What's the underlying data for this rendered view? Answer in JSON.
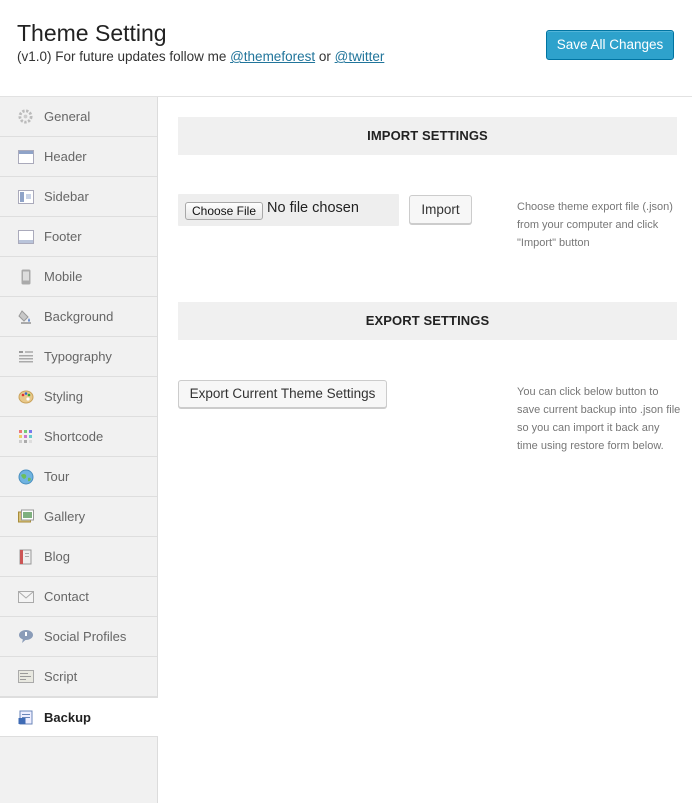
{
  "header": {
    "title": "Theme Setting",
    "subtitle_prefix": "(v1.0) For future updates follow me ",
    "link1": "@themeforest",
    "subtitle_mid": " or ",
    "link2": "@twitter",
    "save_label": "Save All Changes"
  },
  "sidebar": {
    "items": [
      {
        "label": "General",
        "icon": "gear-icon"
      },
      {
        "label": "Header",
        "icon": "header-layout-icon"
      },
      {
        "label": "Sidebar",
        "icon": "sidebar-layout-icon"
      },
      {
        "label": "Footer",
        "icon": "footer-layout-icon"
      },
      {
        "label": "Mobile",
        "icon": "mobile-icon"
      },
      {
        "label": "Background",
        "icon": "paint-bucket-icon"
      },
      {
        "label": "Typography",
        "icon": "typography-icon"
      },
      {
        "label": "Styling",
        "icon": "palette-icon"
      },
      {
        "label": "Shortcode",
        "icon": "shortcode-grid-icon"
      },
      {
        "label": "Tour",
        "icon": "globe-icon"
      },
      {
        "label": "Gallery",
        "icon": "gallery-icon"
      },
      {
        "label": "Blog",
        "icon": "book-icon"
      },
      {
        "label": "Contact",
        "icon": "envelope-icon"
      },
      {
        "label": "Social Profiles",
        "icon": "speech-bubble-icon"
      },
      {
        "label": "Script",
        "icon": "script-icon"
      },
      {
        "label": "Backup",
        "icon": "backup-icon"
      }
    ],
    "active": "Backup"
  },
  "import": {
    "heading": "IMPORT SETTINGS",
    "choose_file_label": "Choose File",
    "no_file_text": "No file chosen",
    "import_label": "Import",
    "help": "Choose theme export file (.json) from your computer and click \"Import\" button"
  },
  "export": {
    "heading": "EXPORT SETTINGS",
    "export_label": "Export Current Theme Settings",
    "help": "You can click below button to save current backup into .json file so you can import it back any time using restore form below."
  },
  "colors": {
    "accent": "#2ea2cc",
    "link": "#21759b",
    "sidebar_bg": "#f1f1f1",
    "section_bg": "#f0f0f0"
  }
}
